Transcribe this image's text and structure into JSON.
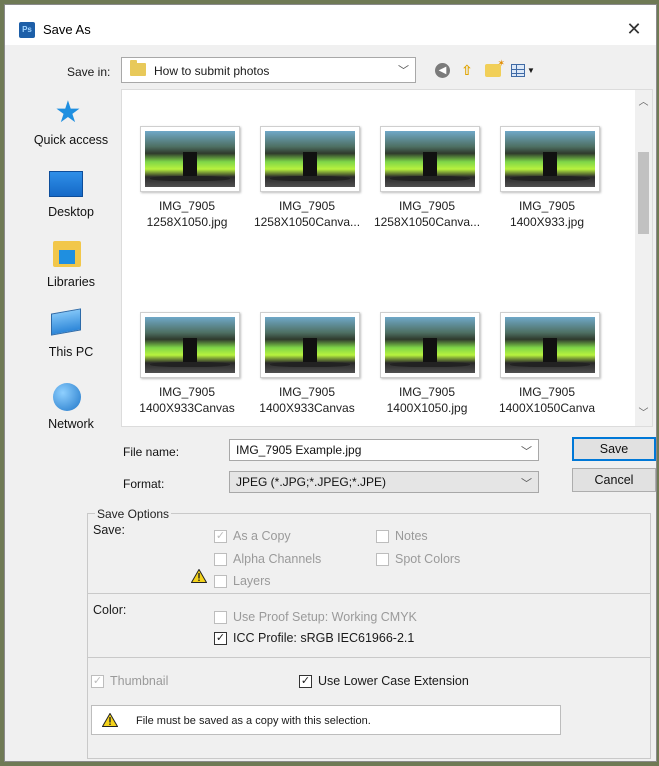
{
  "window": {
    "title": "Save As",
    "app_icon": "Ps"
  },
  "save_in": {
    "label": "Save in:",
    "value": "How to submit photos"
  },
  "places": [
    "Quick access",
    "Desktop",
    "Libraries",
    "This PC",
    "Network"
  ],
  "files": [
    {
      "line1": "IMG_7905",
      "line2": "1258X1050.jpg"
    },
    {
      "line1": "IMG_7905",
      "line2": "1258X1050Canva..."
    },
    {
      "line1": "IMG_7905",
      "line2": "1258X1050Canva..."
    },
    {
      "line1": "IMG_7905",
      "line2": "1400X933.jpg"
    },
    {
      "line1": "IMG_7905",
      "line2": "1400X933Canvas"
    },
    {
      "line1": "IMG_7905",
      "line2": "1400X933Canvas"
    },
    {
      "line1": "IMG_7905",
      "line2": "1400X1050.jpg"
    },
    {
      "line1": "IMG_7905",
      "line2": "1400X1050Canva"
    }
  ],
  "file_name": {
    "label": "File name:",
    "value": "IMG_7905 Example.jpg"
  },
  "format": {
    "label": "Format:",
    "value": "JPEG (*.JPG;*.JPEG;*.JPE)"
  },
  "buttons": {
    "save": "Save",
    "cancel": "Cancel"
  },
  "save_options": {
    "title": "Save Options",
    "save_label": "Save:",
    "as_a_copy": "As a Copy",
    "notes": "Notes",
    "alpha_channels": "Alpha Channels",
    "spot_colors": "Spot Colors",
    "layers": "Layers",
    "color_label": "Color:",
    "use_proof_setup": "Use Proof Setup:  Working CMYK",
    "icc_profile": "ICC Profile:  sRGB IEC61966-2.1",
    "thumbnail": "Thumbnail",
    "lower_case_ext": "Use Lower Case Extension",
    "warning": "File must be saved as a copy with this selection."
  },
  "states": {
    "as_a_copy": true,
    "notes": false,
    "alpha_channels": false,
    "spot_colors": false,
    "layers": false,
    "use_proof_setup": false,
    "icc_profile": true,
    "thumbnail": true,
    "lower_case_ext": true
  },
  "colors": {
    "accent": "#0078d7",
    "warning": "#f3d21b"
  }
}
